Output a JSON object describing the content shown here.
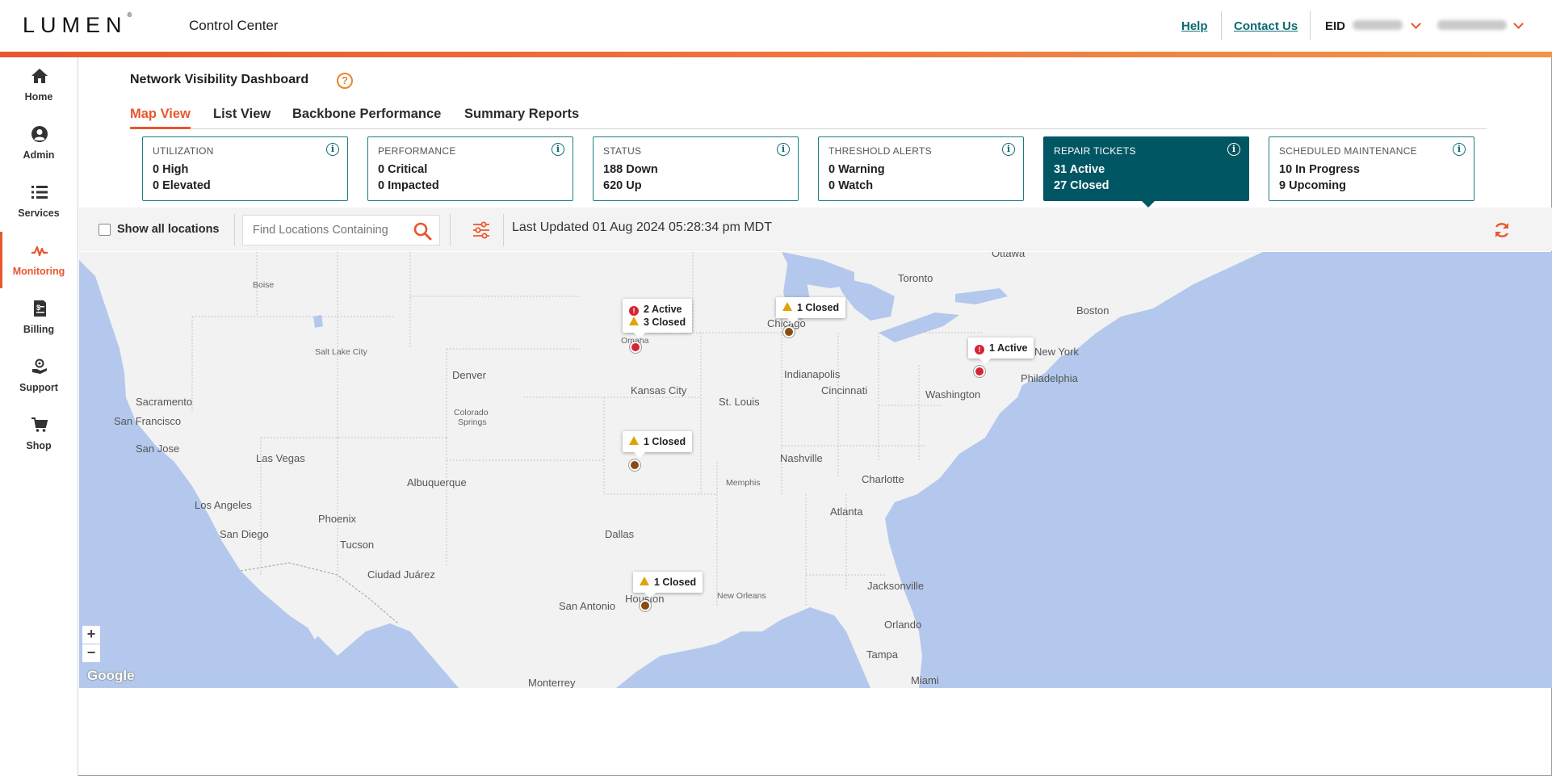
{
  "header": {
    "logo": "LUMEN",
    "logo_mark": "®",
    "app_title": "Control Center",
    "help_link": "Help",
    "contact_link": "Contact Us",
    "eid_label": "EID"
  },
  "sidebar": {
    "items": [
      {
        "label": "Home",
        "icon": "home-icon"
      },
      {
        "label": "Admin",
        "icon": "user-icon"
      },
      {
        "label": "Services",
        "icon": "list-icon"
      },
      {
        "label": "Monitoring",
        "icon": "pulse-icon",
        "active": true
      },
      {
        "label": "Billing",
        "icon": "billing-icon"
      },
      {
        "label": "Support",
        "icon": "support-icon"
      },
      {
        "label": "Shop",
        "icon": "cart-icon"
      }
    ]
  },
  "page": {
    "title": "Network Visibility Dashboard",
    "help_glyph": "?",
    "tabs": [
      "Map View",
      "List View",
      "Backbone Performance",
      "Summary Reports"
    ],
    "active_tab": "Map View"
  },
  "cards": [
    {
      "title": "UTILIZATION",
      "line1": "0 High",
      "line2": "0 Elevated"
    },
    {
      "title": "PERFORMANCE",
      "line1": "0 Critical",
      "line2": "0 Impacted"
    },
    {
      "title": "STATUS",
      "line1": "188 Down",
      "line2": "620 Up"
    },
    {
      "title": "THRESHOLD ALERTS",
      "line1": "0 Warning",
      "line2": "0 Watch"
    },
    {
      "title": "REPAIR TICKETS",
      "line1": "31 Active",
      "line2": "27 Closed",
      "selected": true
    },
    {
      "title": "SCHEDULED MAINTENANCE",
      "line1": "10 In Progress",
      "line2": "9 Upcoming"
    }
  ],
  "toolbar": {
    "show_all_label": "Show all locations",
    "show_all_checked": false,
    "search_placeholder": "Find Locations Containing",
    "last_updated": "Last Updated 01 Aug 2024 05:28:34 pm MDT"
  },
  "map": {
    "cities": {
      "ottawa": "Ottawa",
      "toronto": "Toronto",
      "boston": "Boston",
      "boise": "Boise",
      "salt_lake": "Salt Lake City",
      "denver": "Denver",
      "omaha": "Omaha",
      "chicago": "Chicago",
      "new_york": "New York",
      "philadelphia": "Philadelphia",
      "washington": "Washington",
      "indianapolis": "Indianapolis",
      "cincinnati": "Cincinnati",
      "kansas_city": "Kansas City",
      "st_louis": "St. Louis",
      "sacramento": "Sacramento",
      "san_francisco": "San Francisco",
      "san_jose": "San Jose",
      "colorado_springs_1": "Colorado",
      "colorado_springs_2": "Springs",
      "las_vegas": "Las Vegas",
      "albuquerque": "Albuquerque",
      "nashville": "Nashville",
      "memphis": "Memphis",
      "charlotte": "Charlotte",
      "atlanta": "Atlanta",
      "los_angeles": "Los Angeles",
      "san_diego": "San Diego",
      "phoenix": "Phoenix",
      "tucson": "Tucson",
      "dallas": "Dallas",
      "ciudad_juarez": "Ciudad Juárez",
      "san_antonio": "San Antonio",
      "houston": "Houston",
      "new_orleans": "New Orleans",
      "jacksonville": "Jacksonville",
      "orlando": "Orlando",
      "tampa": "Tampa",
      "miami": "Miami",
      "monterrey": "Monterrey"
    },
    "markers": [
      {
        "name": "omaha",
        "lines": [
          {
            "kind": "error",
            "text": "2 Active"
          },
          {
            "kind": "warning",
            "text": "3 Closed"
          }
        ]
      },
      {
        "name": "chicago",
        "lines": [
          {
            "kind": "warning",
            "text": "1 Closed"
          }
        ]
      },
      {
        "name": "new-york",
        "lines": [
          {
            "kind": "error",
            "text": "1 Active"
          }
        ]
      },
      {
        "name": "tulsa",
        "lines": [
          {
            "kind": "warning",
            "text": "1 Closed"
          }
        ]
      },
      {
        "name": "houston",
        "lines": [
          {
            "kind": "warning",
            "text": "1 Closed"
          }
        ]
      }
    ],
    "zoom_in": "+",
    "zoom_out": "−",
    "attribution": "Google"
  },
  "colors": {
    "brand_orange": "#e8562e",
    "teal": "#0a6b73",
    "selected_card": "#005662",
    "error_red": "#d62433",
    "warning_amber": "#e0a20b",
    "water": "#b3c8ec",
    "land": "#f2f2f2"
  }
}
